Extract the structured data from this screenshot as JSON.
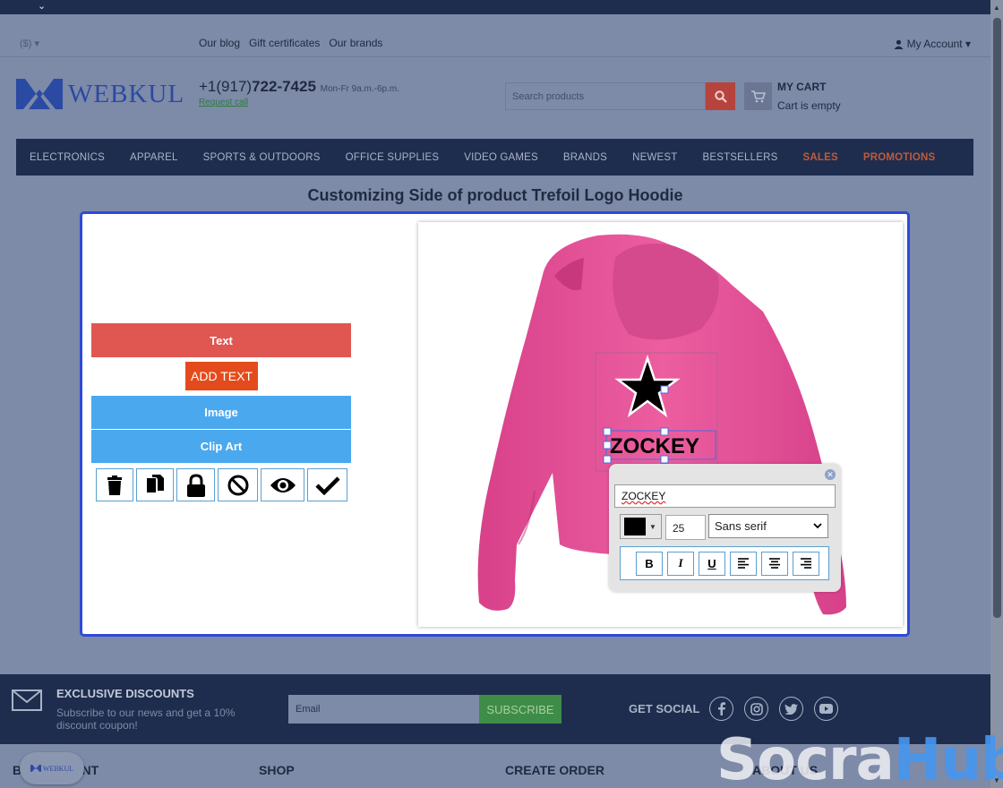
{
  "top_strip": {
    "chevron": "⌄"
  },
  "util_bar": {
    "currency": "($) ▾",
    "links": [
      "Our blog",
      "Gift certificates",
      "Our brands"
    ],
    "account": "My Account ▾"
  },
  "header": {
    "logo_text": "WEBKUL",
    "phone_prefix": "+1(917)",
    "phone_number": "722-7425",
    "phone_hours": "Mon-Fr 9a.m.-6p.m.",
    "request_call": "Request call",
    "search_placeholder": "Search products",
    "cart_title": "MY CART",
    "cart_status": "Cart is empty"
  },
  "menu": {
    "items": [
      "ELECTRONICS",
      "APPAREL",
      "SPORTS & OUTDOORS",
      "OFFICE SUPPLIES",
      "VIDEO GAMES",
      "BRANDS",
      "NEWEST",
      "BESTSELLERS"
    ],
    "hot_items": [
      "SALES",
      "PROMOTIONS"
    ]
  },
  "page_title": "Customizing Side of product Trefoil Logo Hoodie",
  "customizer": {
    "tab_text": "Text",
    "add_text": "ADD TEXT",
    "tab_image": "Image",
    "tab_clipart": "Clip Art",
    "tools": [
      "trash-icon",
      "copy-icon",
      "lock-icon",
      "ban-icon",
      "eye-icon",
      "check-icon"
    ],
    "canvas_text": "ZOCKEY",
    "hoodie_color": "#e8559a"
  },
  "text_editor": {
    "text_value": "ZOCKEY",
    "color": "#000000",
    "font_size": "25",
    "font_family": "Sans serif",
    "format_buttons": [
      "B",
      "I",
      "U"
    ]
  },
  "footer": {
    "discounts_title": "EXCLUSIVE DISCOUNTS",
    "discounts_sub": "Subscribe to our news and get a 10% discount coupon!",
    "email_placeholder": "Email",
    "subscribe": "SUBSCRIBE",
    "social_title": "GET SOCIAL",
    "columns": [
      "B      Y ACCOUNT",
      "SHOP",
      "CREATE ORDER",
      "ABOUT US"
    ],
    "mini_logo": "WEBKUL"
  },
  "watermark": {
    "part1": "Socra",
    "part2": "Hub"
  }
}
